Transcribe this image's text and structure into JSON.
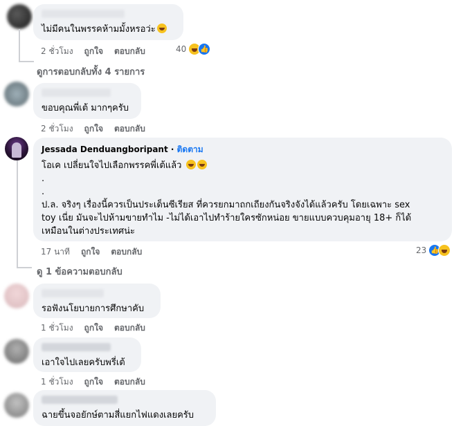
{
  "comments": [
    {
      "text": "ไม่มีคนในพรรคห้ามมั้งหรอว่ะ",
      "time": "2 ชั่วโมง",
      "like": "ถูกใจ",
      "reply": "ตอบกลับ",
      "reactions": "40"
    },
    {
      "text": "ขอบคุณพี่เต้ มากๆครับ",
      "time": "2 ชั่วโมง",
      "like": "ถูกใจ",
      "reply": "ตอบกลับ"
    },
    {
      "author": "Jessada Denduangboripant",
      "follow": "ติดตาม",
      "lines": [
        "โอเค เปลี่ยนใจไปเลือกพรรคพี่เต้แล้ว",
        ".",
        ".",
        "ป.ล. จริงๆ เรื่องนี้ควรเป็นประเด็นซีเรียส ที่ควรยกมาถกเถียงกันจริงจังได้แล้วครับ โดยเฉพาะ sex",
        "toy เนี่ย มันจะไปห้ามขายทำไม -ไม่ได้เอาไปทำร้ายใครซักหน่อย ขายแบบควบคุมอายุ 18+ ก็ได้",
        "เหมือนในต่างประเทศน่ะ"
      ],
      "time": "17 นาที",
      "like": "ถูกใจ",
      "reply": "ตอบกลับ",
      "reactions": "23"
    },
    {
      "text": "รอฟังนโยบายการศึกษาคับ",
      "time": "1 ชั่วโมง",
      "like": "ถูกใจ",
      "reply": "ตอบกลับ"
    },
    {
      "text": "เอาใจไปเลยครับพรี่เต้",
      "time": "1 ชั่วโมง",
      "like": "ถูกใจ",
      "reply": "ตอบกลับ"
    },
    {
      "text": "ฉายขึ้นจอยักษ์ตามสี่แยกไฟแดงเลยครับ"
    }
  ],
  "see_all_replies": "ดูการตอบกลับทั้ง 4 รายการ",
  "see_one_reply": "ดู 1 ข้อความตอบกลับ",
  "icons": {
    "reaction_haha": "haha-emoji-icon",
    "reaction_like": "like-thumb-icon"
  },
  "colors": {
    "bubble": "#f0f2f5",
    "link": "#1877f2",
    "meta": "#65676b"
  }
}
